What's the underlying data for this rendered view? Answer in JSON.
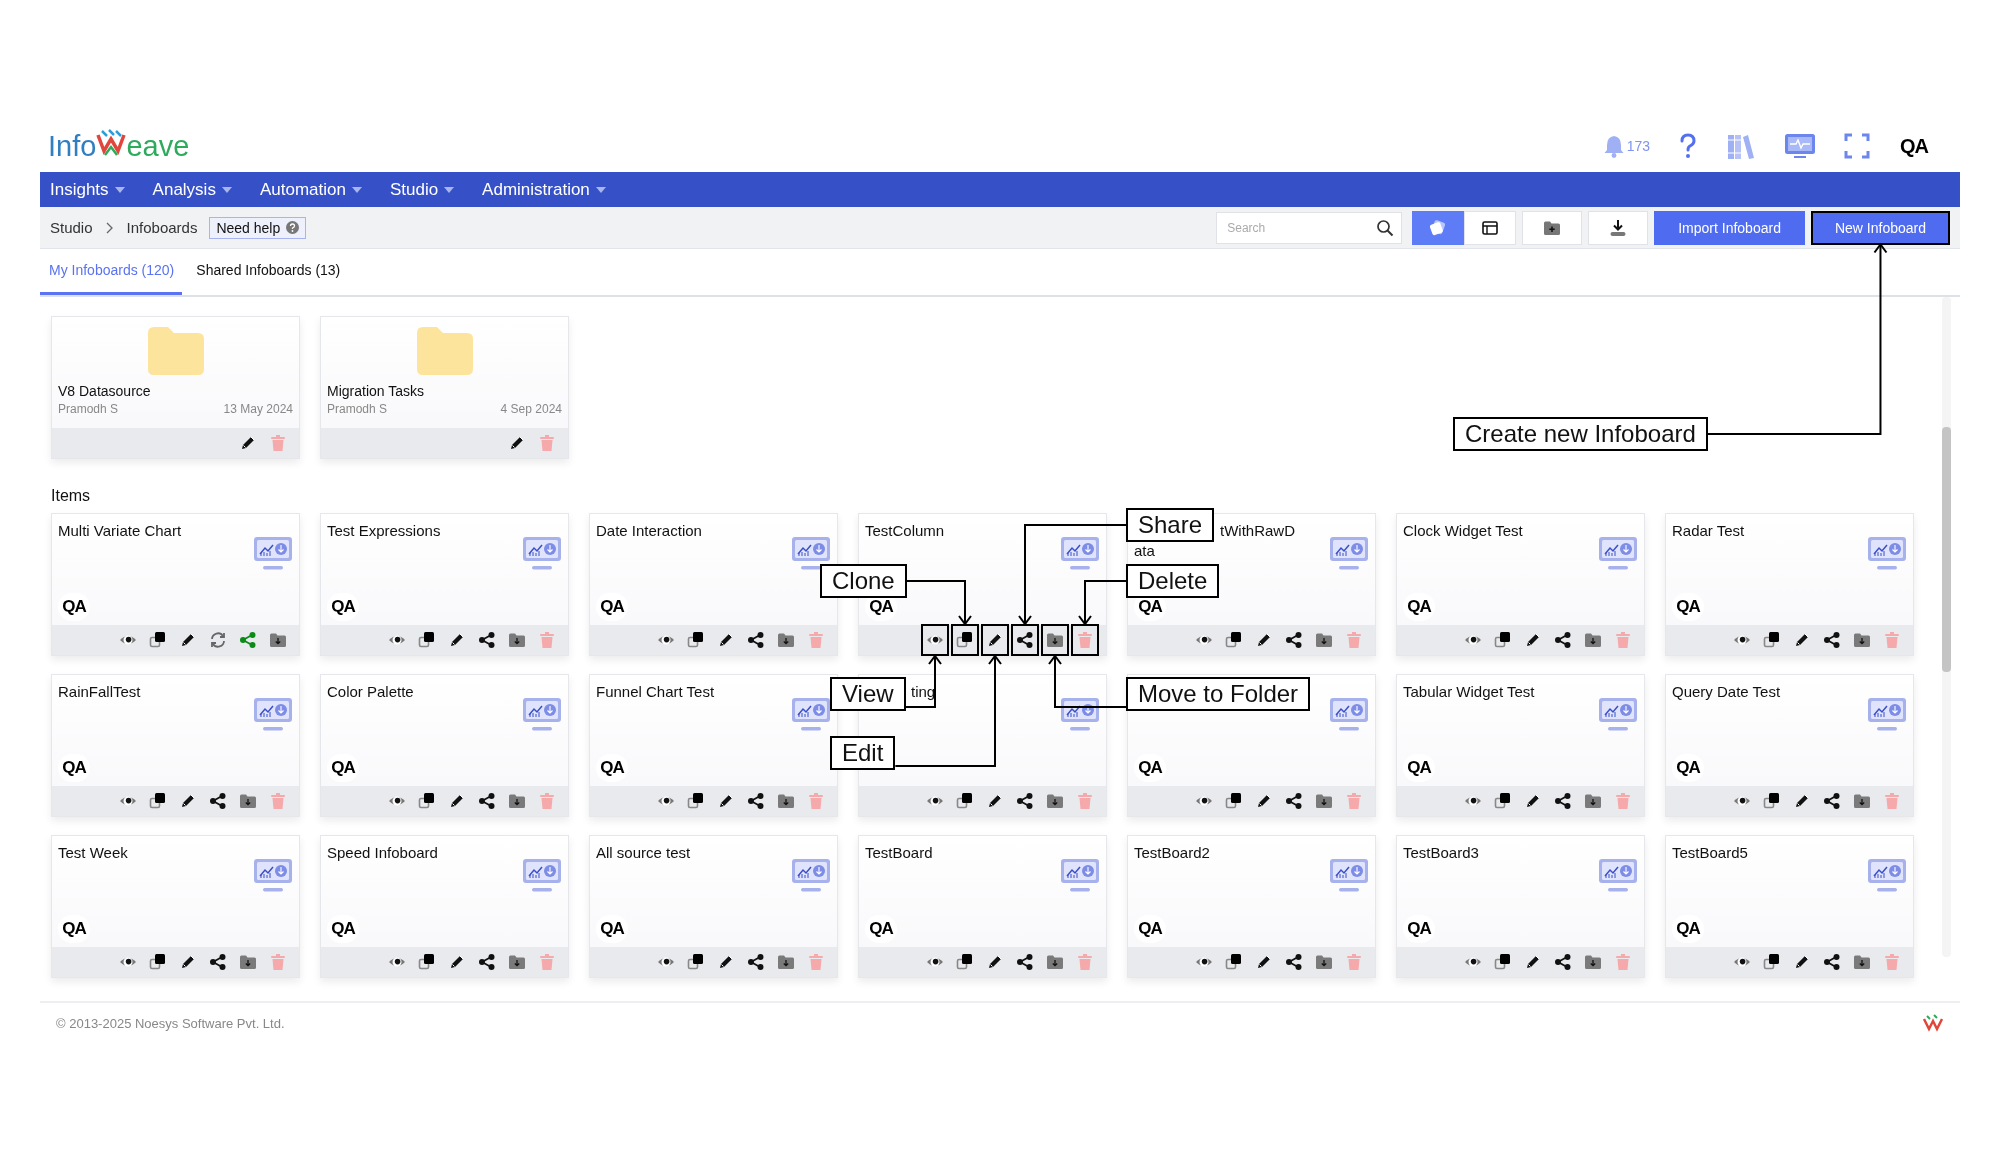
{
  "header": {
    "logo": {
      "first": "Info",
      "last": "eave"
    },
    "notifications": "173",
    "avatar": "QA"
  },
  "menu": [
    {
      "label": "Insights"
    },
    {
      "label": "Analysis"
    },
    {
      "label": "Automation"
    },
    {
      "label": "Studio"
    },
    {
      "label": "Administration"
    }
  ],
  "breadcrumb": [
    "Studio",
    "Infoboards"
  ],
  "help": "Need help",
  "search": {
    "placeholder": "Search"
  },
  "view_toggle": [
    {
      "kind": "cards",
      "selected": true
    },
    {
      "kind": "list",
      "selected": false
    }
  ],
  "buttons": [
    {
      "label": "Import Infoboard",
      "highlighted": false
    },
    {
      "label": "New Infoboard",
      "highlighted": true
    }
  ],
  "tabs": [
    {
      "label": "My Infoboards (120)",
      "selected": true
    },
    {
      "label": "Shared Infoboards (13)",
      "selected": false
    }
  ],
  "folders": [
    {
      "name": "V8 Datasource",
      "owner": "Pramodh S",
      "date": "13 May 2024"
    },
    {
      "name": "Migration Tasks",
      "owner": "Pramodh S",
      "date": "4 Sep 2024"
    }
  ],
  "items_heading": "Items",
  "items": [
    {
      "title": "Multi Variate Chart",
      "avatar": "QA",
      "actions": [
        {
          "kind": "view"
        },
        {
          "kind": "clone"
        },
        {
          "kind": "edit"
        },
        {
          "kind": "refresh"
        },
        {
          "kind": "share",
          "active": true
        },
        {
          "kind": "move"
        }
      ],
      "annotated": false
    },
    {
      "title": "Test Expressions",
      "avatar": "QA",
      "actions": [
        {
          "kind": "view"
        },
        {
          "kind": "clone"
        },
        {
          "kind": "edit"
        },
        {
          "kind": "share",
          "active": false
        },
        {
          "kind": "move"
        },
        {
          "kind": "delete"
        }
      ],
      "annotated": false
    },
    {
      "title": "Date Interaction",
      "avatar": "QA",
      "actions": [
        {
          "kind": "view"
        },
        {
          "kind": "clone"
        },
        {
          "kind": "edit"
        },
        {
          "kind": "share",
          "active": false
        },
        {
          "kind": "move"
        },
        {
          "kind": "delete"
        }
      ],
      "annotated": false
    },
    {
      "title": "TestColumn",
      "avatar": "QA",
      "actions": [
        {
          "kind": "view"
        },
        {
          "kind": "clone"
        },
        {
          "kind": "edit"
        },
        {
          "kind": "share",
          "active": false
        },
        {
          "kind": "move"
        },
        {
          "kind": "delete"
        }
      ],
      "annotated": true
    },
    {
      "title": "tWithRawD\nata",
      "covered": true,
      "avatar": "QA",
      "actions": [
        {
          "kind": "view"
        },
        {
          "kind": "clone"
        },
        {
          "kind": "edit"
        },
        {
          "kind": "share",
          "active": false
        },
        {
          "kind": "move"
        },
        {
          "kind": "delete"
        }
      ],
      "annotated": false
    },
    {
      "title": "Clock Widget Test",
      "avatar": "QA",
      "actions": [
        {
          "kind": "view"
        },
        {
          "kind": "clone"
        },
        {
          "kind": "edit"
        },
        {
          "kind": "share",
          "active": false
        },
        {
          "kind": "move"
        },
        {
          "kind": "delete"
        }
      ],
      "annotated": false
    },
    {
      "title": "Radar Test",
      "avatar": "QA",
      "actions": [
        {
          "kind": "view"
        },
        {
          "kind": "clone"
        },
        {
          "kind": "edit"
        },
        {
          "kind": "share",
          "active": false
        },
        {
          "kind": "move"
        },
        {
          "kind": "delete"
        }
      ],
      "annotated": false
    },
    {
      "title": "RainFallTest",
      "avatar": "QA",
      "actions": [
        {
          "kind": "view"
        },
        {
          "kind": "clone"
        },
        {
          "kind": "edit"
        },
        {
          "kind": "share",
          "active": false
        },
        {
          "kind": "move"
        },
        {
          "kind": "delete"
        }
      ],
      "annotated": false
    },
    {
      "title": "Color Palette",
      "avatar": "QA",
      "actions": [
        {
          "kind": "view"
        },
        {
          "kind": "clone"
        },
        {
          "kind": "edit"
        },
        {
          "kind": "share",
          "active": false
        },
        {
          "kind": "move"
        },
        {
          "kind": "delete"
        }
      ],
      "annotated": false
    },
    {
      "title": "Funnel Chart Test",
      "avatar": "QA",
      "actions": [
        {
          "kind": "view"
        },
        {
          "kind": "clone"
        },
        {
          "kind": "edit"
        },
        {
          "kind": "share",
          "active": false
        },
        {
          "kind": "move"
        },
        {
          "kind": "delete"
        }
      ],
      "annotated": false
    },
    {
      "title": "ting",
      "covered": true,
      "actions": [
        {
          "kind": "view"
        },
        {
          "kind": "clone"
        },
        {
          "kind": "edit"
        },
        {
          "kind": "share",
          "active": false
        },
        {
          "kind": "move"
        },
        {
          "kind": "delete"
        }
      ],
      "annotated": false
    },
    {
      "avatar": "QA",
      "actions": [
        {
          "kind": "view"
        },
        {
          "kind": "clone"
        },
        {
          "kind": "edit"
        },
        {
          "kind": "share",
          "active": false
        },
        {
          "kind": "move"
        },
        {
          "kind": "delete"
        }
      ],
      "annotated": false
    },
    {
      "title": "Tabular Widget Test",
      "avatar": "QA",
      "actions": [
        {
          "kind": "view"
        },
        {
          "kind": "clone"
        },
        {
          "kind": "edit"
        },
        {
          "kind": "share",
          "active": false
        },
        {
          "kind": "move"
        },
        {
          "kind": "delete"
        }
      ],
      "annotated": false
    },
    {
      "title": "Query Date Test",
      "avatar": "QA",
      "actions": [
        {
          "kind": "view"
        },
        {
          "kind": "clone"
        },
        {
          "kind": "edit"
        },
        {
          "kind": "share",
          "active": false
        },
        {
          "kind": "move"
        },
        {
          "kind": "delete"
        }
      ],
      "annotated": false
    },
    {
      "title": "Test Week",
      "avatar": "QA",
      "actions": [
        {
          "kind": "view"
        },
        {
          "kind": "clone"
        },
        {
          "kind": "edit"
        },
        {
          "kind": "share",
          "active": false
        },
        {
          "kind": "move"
        },
        {
          "kind": "delete"
        }
      ],
      "annotated": false
    },
    {
      "title": "Speed Infoboard",
      "avatar": "QA",
      "actions": [
        {
          "kind": "view"
        },
        {
          "kind": "clone"
        },
        {
          "kind": "edit"
        },
        {
          "kind": "share",
          "active": false
        },
        {
          "kind": "move"
        },
        {
          "kind": "delete"
        }
      ],
      "annotated": false
    },
    {
      "title": "All source test",
      "avatar": "QA",
      "actions": [
        {
          "kind": "view"
        },
        {
          "kind": "clone"
        },
        {
          "kind": "edit"
        },
        {
          "kind": "share",
          "active": false
        },
        {
          "kind": "move"
        },
        {
          "kind": "delete"
        }
      ],
      "annotated": false
    },
    {
      "title": "TestBoard",
      "avatar": "QA",
      "actions": [
        {
          "kind": "view"
        },
        {
          "kind": "clone"
        },
        {
          "kind": "edit"
        },
        {
          "kind": "share",
          "active": false
        },
        {
          "kind": "move"
        },
        {
          "kind": "delete"
        }
      ],
      "annotated": false
    },
    {
      "title": "TestBoard2",
      "avatar": "QA",
      "actions": [
        {
          "kind": "view"
        },
        {
          "kind": "clone"
        },
        {
          "kind": "edit"
        },
        {
          "kind": "share",
          "active": false
        },
        {
          "kind": "move"
        },
        {
          "kind": "delete"
        }
      ],
      "annotated": false
    },
    {
      "title": "TestBoard3",
      "avatar": "QA",
      "actions": [
        {
          "kind": "view"
        },
        {
          "kind": "clone"
        },
        {
          "kind": "edit"
        },
        {
          "kind": "share",
          "active": false
        },
        {
          "kind": "move"
        },
        {
          "kind": "delete"
        }
      ],
      "annotated": false
    },
    {
      "title": "TestBoard5",
      "avatar": "QA",
      "actions": [
        {
          "kind": "view"
        },
        {
          "kind": "clone"
        },
        {
          "kind": "edit"
        },
        {
          "kind": "share",
          "active": false
        },
        {
          "kind": "move"
        },
        {
          "kind": "delete"
        }
      ],
      "annotated": false
    }
  ],
  "callouts": [
    {
      "text": "Create new Infoboard"
    },
    {
      "text": "Share"
    },
    {
      "text": "Clone"
    },
    {
      "text": "Delete"
    },
    {
      "text": "View"
    },
    {
      "text": "Move to Folder"
    },
    {
      "text": "Edit"
    }
  ],
  "footer": {
    "copyright": "© 2013-2025 Noesys Software Pvt. Ltd."
  }
}
